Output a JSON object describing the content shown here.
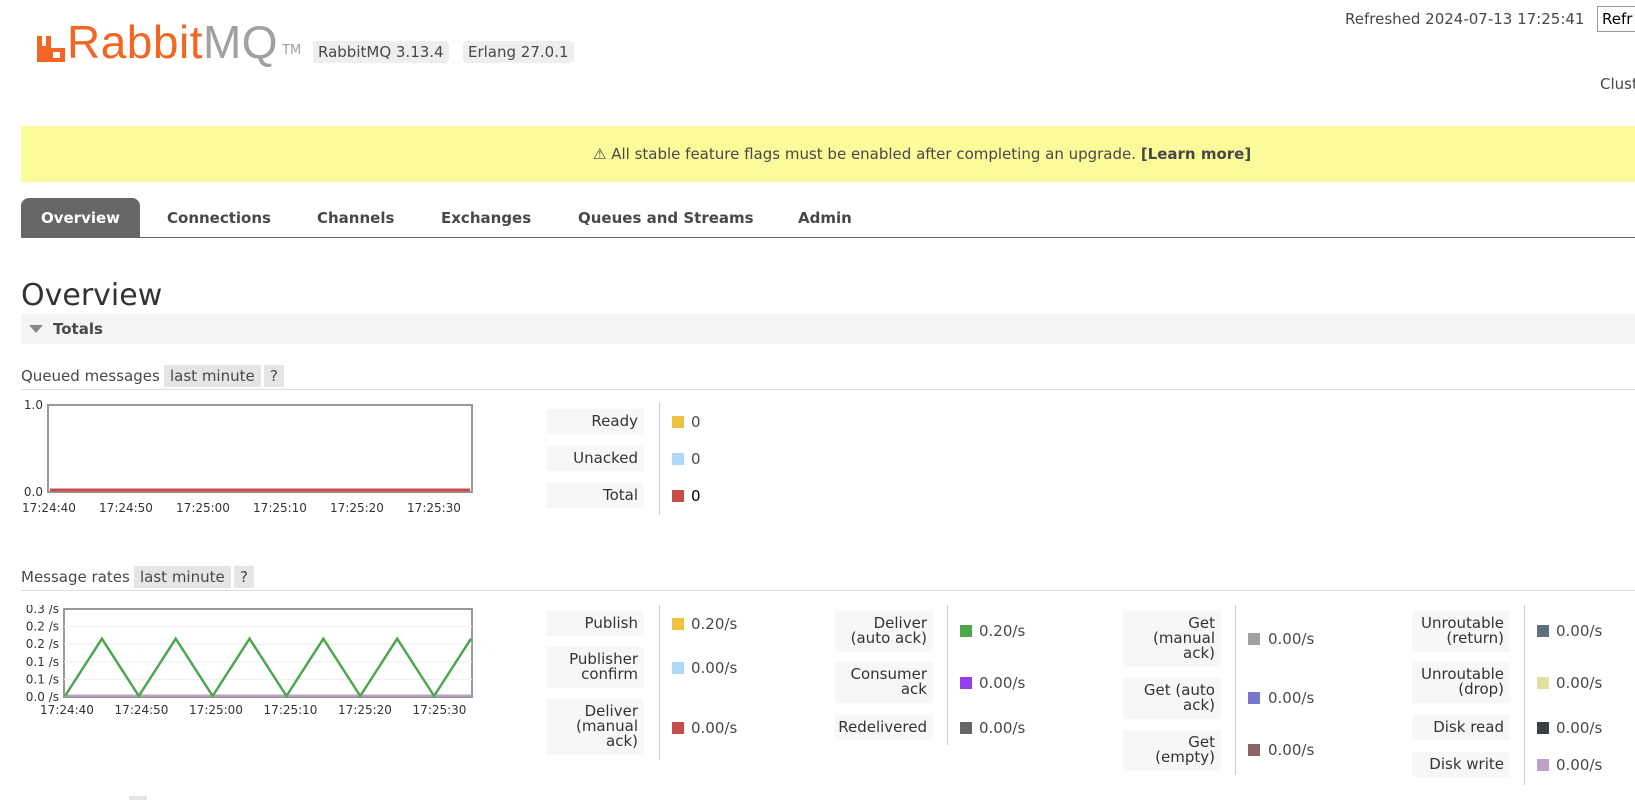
{
  "header": {
    "logo": {
      "brand_rabbit": "Rabbit",
      "brand_mq": "MQ",
      "trademark": "TM",
      "icon": "rabbitmq-logo-icon"
    },
    "rabbitmq_version": "RabbitMQ 3.13.4",
    "erlang_version": "Erlang 27.0.1",
    "refreshed": "Refreshed 2024-07-13 17:25:41",
    "refresh_button": "Refr",
    "cluster_label": "Clust"
  },
  "banner": {
    "icon": "warning-icon",
    "icon_glyph": "⚠",
    "text": "All stable feature flags must be enabled after completing an upgrade.",
    "link": "[Learn more]",
    "color": "#fbfb9a"
  },
  "tabs": [
    {
      "label": "Overview",
      "active": true
    },
    {
      "label": "Connections",
      "active": false
    },
    {
      "label": "Channels",
      "active": false
    },
    {
      "label": "Exchanges",
      "active": false
    },
    {
      "label": "Queues and Streams",
      "active": false
    },
    {
      "label": "Admin",
      "active": false
    }
  ],
  "page": {
    "title": "Overview",
    "section": "Totals"
  },
  "queued_messages": {
    "label": "Queued messages",
    "range": "last minute",
    "help": "?",
    "legend": [
      {
        "label": "Ready",
        "value": "0",
        "color": "#edc240"
      },
      {
        "label": "Unacked",
        "value": "0",
        "color": "#afd8f8"
      },
      {
        "label": "Total",
        "value": "0",
        "color": "#cb4b4b"
      }
    ]
  },
  "message_rates": {
    "label": "Message rates",
    "range": "last minute",
    "help": "?",
    "columns": [
      [
        {
          "label": [
            "Publish"
          ],
          "value": "0.20/s",
          "color": "#edc240"
        },
        {
          "label": [
            "Publisher",
            "confirm"
          ],
          "value": "0.00/s",
          "color": "#afd8f8"
        },
        {
          "label": [
            "Deliver",
            "(manual",
            "ack)"
          ],
          "value": "0.00/s",
          "color": "#cb4b4b"
        }
      ],
      [
        {
          "label": [
            "Deliver",
            "(auto ack)"
          ],
          "value": "0.20/s",
          "color": "#4da74d"
        },
        {
          "label": [
            "Consumer",
            "ack"
          ],
          "value": "0.00/s",
          "color": "#9440ed"
        },
        {
          "label": [
            "Redelivered"
          ],
          "value": "0.00/s",
          "color": "#666666"
        }
      ],
      [
        {
          "label": [
            "Get",
            "(manual",
            "ack)"
          ],
          "value": "0.00/s",
          "color": "#a0a0a0"
        },
        {
          "label": [
            "Get (auto",
            "ack)"
          ],
          "value": "0.00/s",
          "color": "#7777cc"
        },
        {
          "label": [
            "Get",
            "(empty)"
          ],
          "value": "0.00/s",
          "color": "#8a6464"
        }
      ],
      [
        {
          "label": [
            "Unroutable",
            "(return)"
          ],
          "value": "0.00/s",
          "color": "#607080"
        },
        {
          "label": [
            "Unroutable",
            "(drop)"
          ],
          "value": "0.00/s",
          "color": "#e0e0a0"
        },
        {
          "label": [
            "Disk read"
          ],
          "value": "0.00/s",
          "color": "#3a3f48"
        },
        {
          "label": [
            "Disk write"
          ],
          "value": "0.00/s",
          "color": "#c0a0c8"
        }
      ]
    ]
  },
  "chart_data": [
    {
      "type": "line",
      "name": "queued-messages",
      "x": [
        "17:24:40",
        "17:24:50",
        "17:25:00",
        "17:25:10",
        "17:25:20",
        "17:25:30"
      ],
      "ylim": [
        0,
        1.0
      ],
      "yticks": [
        "0.0",
        "1.0"
      ],
      "series": [
        {
          "name": "Total",
          "color": "#cb4b4b",
          "values": [
            0,
            0,
            0,
            0,
            0,
            0,
            0
          ]
        }
      ]
    },
    {
      "type": "line",
      "name": "message-rates",
      "x": [
        "17:24:40",
        "17:24:50",
        "17:25:00",
        "17:25:10",
        "17:25:20",
        "17:25:30"
      ],
      "ylim": [
        0,
        0.3
      ],
      "yticks": [
        "0.0 /s",
        "0.1 /s",
        "0.1 /s",
        "0.2 /s",
        "0.2 /s",
        "0.3 /s"
      ],
      "series": [
        {
          "name": "Deliver (auto ack)",
          "color": "#4da74d",
          "t": [
            0,
            5,
            10,
            15,
            20,
            25,
            30,
            35,
            40,
            45,
            50,
            55
          ],
          "values": [
            0,
            0.2,
            0,
            0.2,
            0,
            0.2,
            0,
            0.2,
            0,
            0.2,
            0,
            0.2
          ]
        }
      ]
    }
  ]
}
